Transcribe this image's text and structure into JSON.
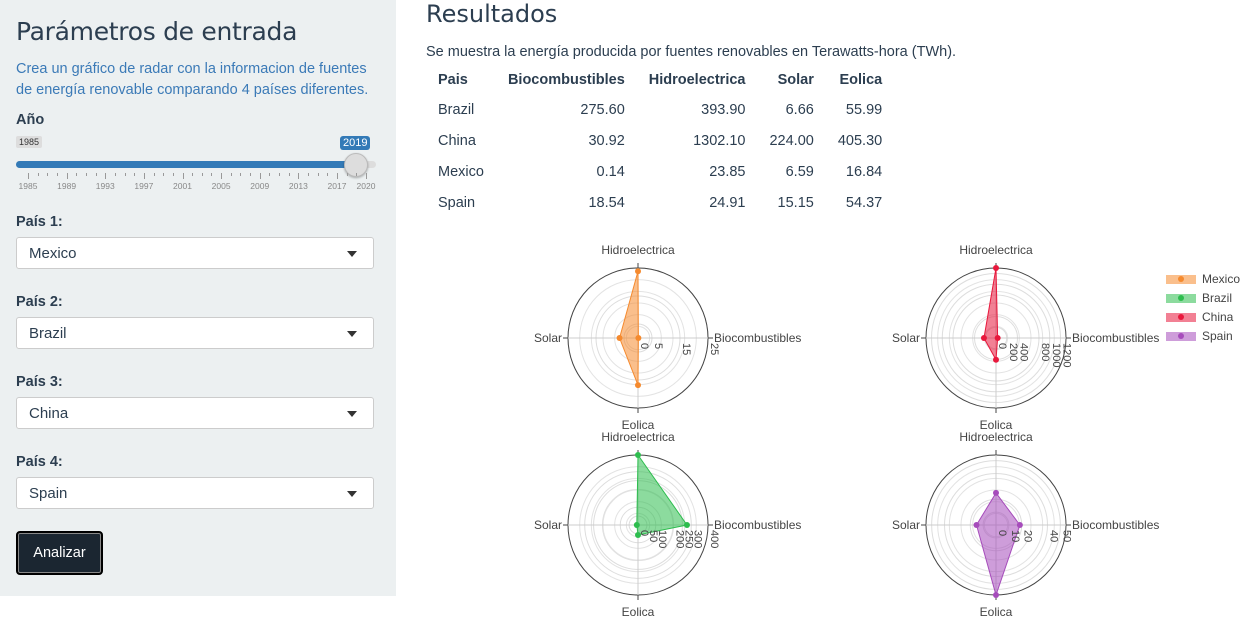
{
  "sidebar": {
    "title": "Parámetros de entrada",
    "description": "Crea un gráfico de radar con la informacion de fuentes de energía renovable comparando 4 países diferentes.",
    "year_label": "Año",
    "slider": {
      "min_value": "1985",
      "selected_value": "2019",
      "ticks": [
        "1985",
        "1989",
        "1993",
        "1997",
        "2001",
        "2005",
        "2009",
        "2013",
        "2017",
        "2020"
      ]
    },
    "country1_label": "País 1:",
    "country1_value": "Mexico",
    "country2_label": "País 2:",
    "country2_value": "Brazil",
    "country3_label": "País 3:",
    "country3_value": "China",
    "country4_label": "País 4:",
    "country4_value": "Spain",
    "button_label": "Analizar"
  },
  "main": {
    "title": "Resultados",
    "intro": "Se muestra la energía producida por fuentes renovables en Terawatts-hora (TWh).",
    "table": {
      "headers": [
        "Pais",
        "Biocombustibles",
        "Hidroelectrica",
        "Solar",
        "Eolica"
      ],
      "rows": [
        [
          "Brazil",
          "275.60",
          "393.90",
          "6.66",
          "55.99"
        ],
        [
          "China",
          "30.92",
          "1302.10",
          "224.00",
          "405.30"
        ],
        [
          "Mexico",
          "0.14",
          "23.85",
          "6.59",
          "16.84"
        ],
        [
          "Spain",
          "18.54",
          "24.91",
          "15.15",
          "54.37"
        ]
      ]
    }
  },
  "chart_data": {
    "type": "radar",
    "axes": [
      "Hidroelectrica",
      "Biocombustibles",
      "Eolica",
      "Solar"
    ],
    "legend": [
      "Mexico",
      "Brazil",
      "China",
      "Spain"
    ],
    "colors": {
      "Mexico": "#f58a2e",
      "Brazil": "#2dbd4e",
      "China": "#e8183c",
      "Spain": "#a64cbb"
    },
    "charts": [
      {
        "series": "Mexico",
        "values": {
          "Hidroelectrica": 23.85,
          "Biocombustibles": 0.14,
          "Eolica": 16.84,
          "Solar": 6.59
        },
        "rmax": 25,
        "ticks": [
          "0",
          "5",
          "15",
          "25"
        ],
        "tick_values": [
          0,
          5,
          15,
          25
        ]
      },
      {
        "series": "China",
        "values": {
          "Hidroelectrica": 1302.1,
          "Biocombustibles": 30.92,
          "Eolica": 405.3,
          "Solar": 224.0
        },
        "rmax": 1302.1,
        "ticks": [
          "0",
          "200",
          "400",
          "800",
          "1000",
          "1200"
        ],
        "tick_values": [
          0,
          200,
          400,
          800,
          1000,
          1200
        ]
      },
      {
        "series": "Brazil",
        "values": {
          "Hidroelectrica": 393.9,
          "Biocombustibles": 275.6,
          "Eolica": 55.99,
          "Solar": 6.66
        },
        "rmax": 393.9,
        "ticks": [
          "0",
          "50",
          "100",
          "200",
          "250",
          "300",
          "400"
        ],
        "tick_values": [
          0,
          50,
          100,
          200,
          250,
          300,
          400
        ]
      },
      {
        "series": "Spain",
        "values": {
          "Hidroelectrica": 24.91,
          "Biocombustibles": 18.54,
          "Eolica": 54.37,
          "Solar": 15.15
        },
        "rmax": 54.37,
        "ticks": [
          "0",
          "10",
          "20",
          "40",
          "50"
        ],
        "tick_values": [
          0,
          10,
          20,
          40,
          50
        ]
      }
    ]
  }
}
